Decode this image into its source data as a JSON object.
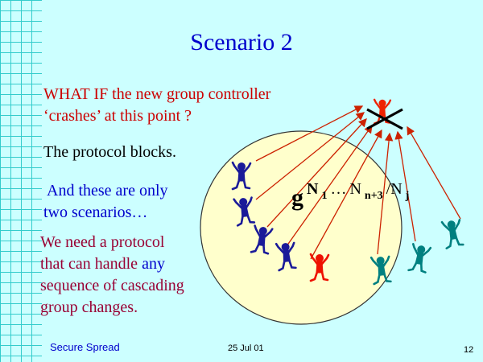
{
  "slide": {
    "title": "Scenario 2",
    "lines": {
      "what_if_1": "WHAT IF the new group controller",
      "what_if_2": "‘crashes’ at this point ?",
      "blocks": "The protocol blocks.",
      "only_1": "And these are only",
      "only_2": "two scenarios…",
      "need_1": "We need a protocol",
      "need_2a": "that can handle ",
      "need_2b": "any",
      "need_3": "sequence of cascading",
      "need_4": "group changes."
    },
    "formula": {
      "base": "g",
      "exp_start": "N",
      "sub1": "1",
      "dots": "…",
      "exp_mid": "N",
      "sub2": "n+3",
      "exp_end": "/N",
      "sub3": "j"
    },
    "footer": {
      "left": "Secure Spread",
      "date": "25 Jul 01",
      "page": "12"
    },
    "icons": [
      "crossed-out-controller-figure",
      "group-member-figure",
      "leaving-member-figure"
    ],
    "colors": {
      "background": "#ccffff",
      "grid": "#33cccc",
      "title": "#0000cc",
      "circle": "#ffffcc",
      "arrows": "#cc2200",
      "member_blue": "#1a1a99",
      "member_red": "#ee1100",
      "member_teal": "#008080"
    }
  }
}
